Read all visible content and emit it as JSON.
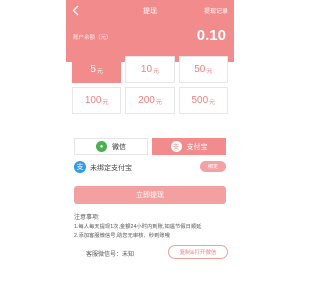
{
  "header": {
    "title": "提现",
    "records_link": "提现记录",
    "balance_label": "账户余额（元）",
    "balance_value": "0.10"
  },
  "amounts": [
    {
      "value": "5",
      "unit": "元",
      "selected": true
    },
    {
      "value": "10",
      "unit": "元",
      "selected": false
    },
    {
      "value": "50",
      "unit": "元",
      "selected": false
    },
    {
      "value": "100",
      "unit": "元",
      "selected": false
    },
    {
      "value": "200",
      "unit": "元",
      "selected": false
    },
    {
      "value": "500",
      "unit": "元",
      "selected": false
    }
  ],
  "payment": {
    "wechat_label": "微信",
    "alipay_label": "支付宝",
    "selected": "alipay",
    "wechat_glyph": "●",
    "alipay_glyph": "支"
  },
  "bind": {
    "glyph": "支",
    "text": "未绑定支付宝",
    "button": "绑定"
  },
  "submit": {
    "label": "立即提现"
  },
  "notice": {
    "title": "注意事项:",
    "line1": "1.每人每天提现1次,金额24小时内到账,如遇节假日顺延",
    "line2": "2.添加客服微信号,助您无审核、秒到账哦"
  },
  "service": {
    "label": "客服微信号：未知",
    "copy_button": "复制&打开微信"
  },
  "icons": {
    "back": "chevron-left-icon"
  },
  "colors": {
    "accent": "#f28b8b",
    "accent_light": "#f2a0a0",
    "wechat": "#4caf50",
    "alipay": "#2f9cf0"
  }
}
